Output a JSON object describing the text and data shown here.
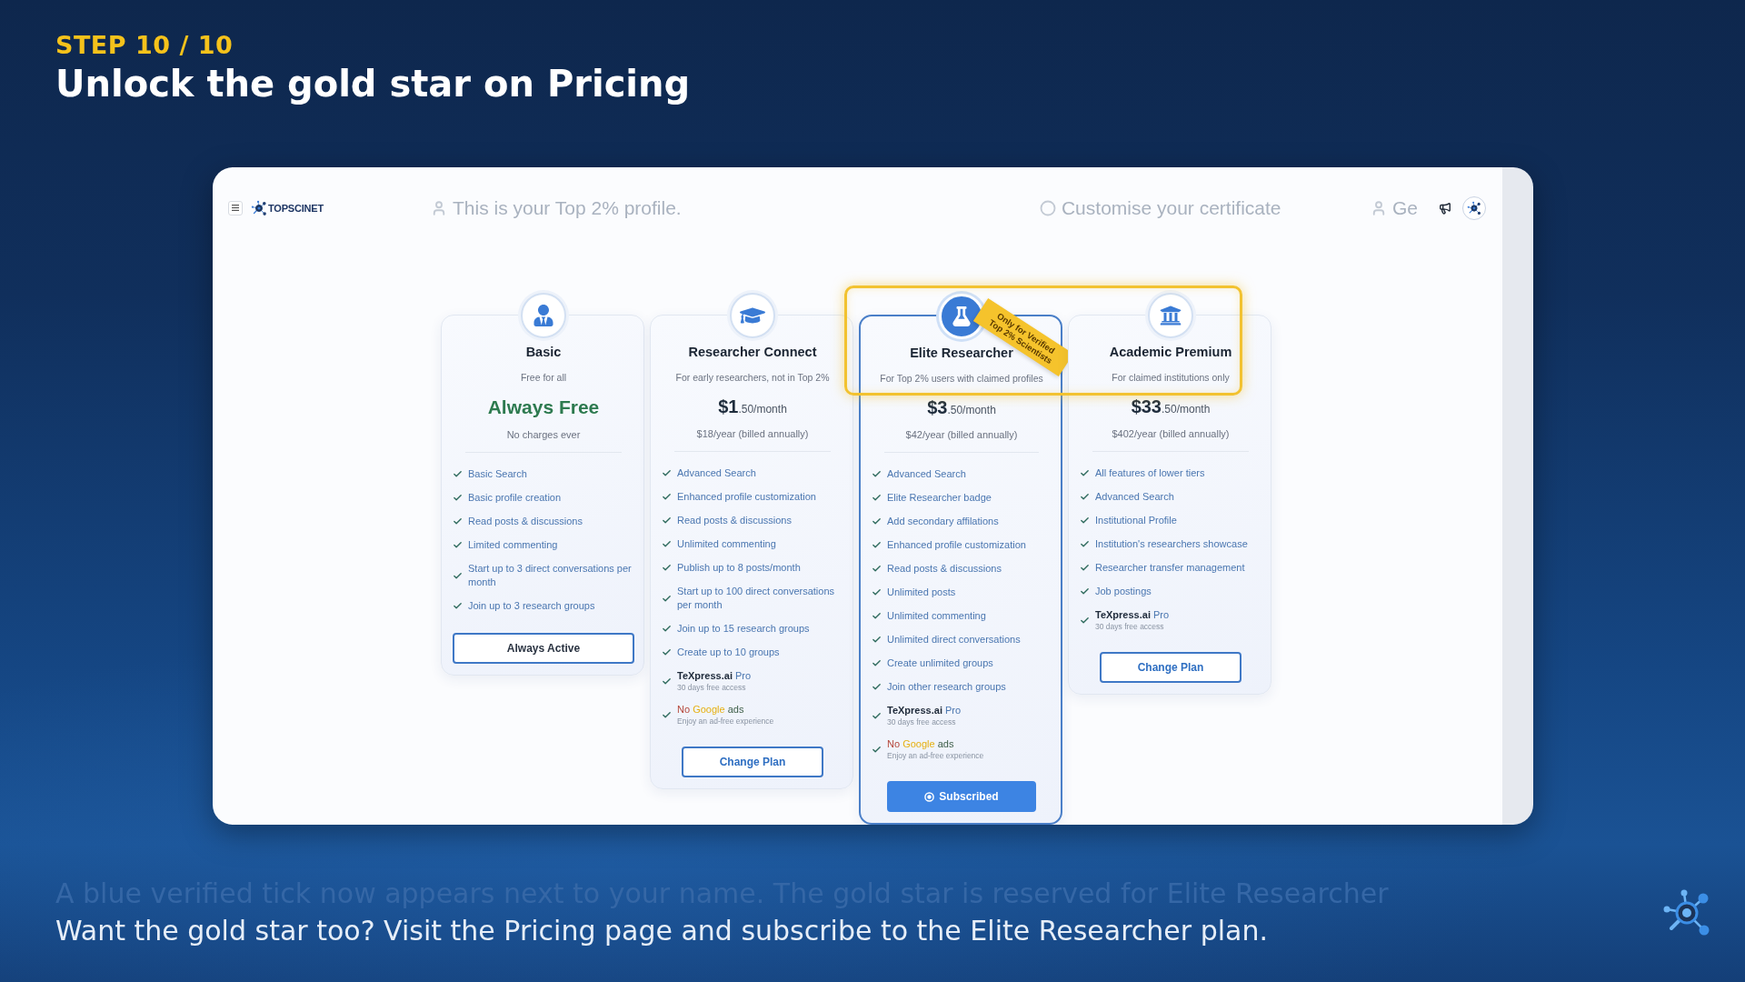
{
  "header": {
    "step": "STEP 10 / 10",
    "title": "Unlock the gold star on Pricing"
  },
  "app": {
    "top_bar": {
      "logo_text": "TOPSCINET",
      "faded_items": [
        {
          "text": "This is your Top 2% profile."
        },
        {
          "text": "Customise your certificate"
        },
        {
          "text": "Ge"
        }
      ]
    },
    "plans": [
      {
        "name": "Basic",
        "current": false,
        "subtitle": "Free for all",
        "price": {
          "kind": "free",
          "amount": "Always Free"
        },
        "billing": "No charges ever",
        "features": [
          {
            "kind": "plain",
            "text": "Basic Search"
          },
          {
            "kind": "plain",
            "text": "Basic profile creation"
          },
          {
            "kind": "plain",
            "text": "Read posts & discussions"
          },
          {
            "kind": "plain",
            "text": "Limited commenting"
          },
          {
            "kind": "plain",
            "text": "Start up to 3 direct conversations per month"
          },
          {
            "kind": "plain",
            "text": "Join up to 3 research groups"
          }
        ],
        "button": {
          "kind": "always_active",
          "label": "Always Active"
        }
      },
      {
        "name": "Researcher Connect",
        "current": false,
        "subtitle": "For early researchers, not in Top 2%",
        "price": {
          "kind": "paid",
          "amount": "$1",
          "period": ".50/month"
        },
        "billing": "$18/year (billed annually)",
        "features": [
          {
            "kind": "plain",
            "text": "Advanced Search"
          },
          {
            "kind": "plain",
            "text": "Enhanced profile customization"
          },
          {
            "kind": "plain",
            "text": "Read posts & discussions"
          },
          {
            "kind": "plain",
            "text": "Unlimited commenting"
          },
          {
            "kind": "plain",
            "text": "Publish up to 8 posts/month"
          },
          {
            "kind": "plain",
            "text": "Start up to 100 direct conversations per month"
          },
          {
            "kind": "plain",
            "text": "Join up to 15 research groups"
          },
          {
            "kind": "plain",
            "text": "Create up to 10 groups"
          },
          {
            "kind": "product",
            "product": "TeXpress.ai",
            "tier": "Pro",
            "note": "30 days free access"
          },
          {
            "kind": "no_ads",
            "lead": "No",
            "brand": "Google",
            "tail": "ads",
            "note": "Enjoy an ad-free experience"
          }
        ],
        "button": {
          "kind": "change",
          "label": "Change Plan"
        }
      },
      {
        "name": "Elite Researcher",
        "current": true,
        "ribbon": "Only for Verified Top 2% Scientists",
        "subtitle": "For Top 2% users with claimed profiles",
        "price": {
          "kind": "paid",
          "amount": "$3",
          "period": ".50/month"
        },
        "billing": "$42/year (billed annually)",
        "features": [
          {
            "kind": "plain",
            "text": "Advanced Search"
          },
          {
            "kind": "plain",
            "text": "Elite Researcher badge"
          },
          {
            "kind": "plain",
            "text": "Add secondary affilations"
          },
          {
            "kind": "plain",
            "text": "Enhanced profile customization"
          },
          {
            "kind": "plain",
            "text": "Read posts & discussions"
          },
          {
            "kind": "plain",
            "text": "Unlimited posts"
          },
          {
            "kind": "plain",
            "text": "Unlimited commenting"
          },
          {
            "kind": "plain",
            "text": "Unlimited direct conversations"
          },
          {
            "kind": "plain",
            "text": "Create unlimited groups"
          },
          {
            "kind": "plain",
            "text": "Join other research groups"
          },
          {
            "kind": "product",
            "product": "TeXpress.ai",
            "tier": "Pro",
            "note": "30 days free access"
          },
          {
            "kind": "no_ads",
            "lead": "No",
            "brand": "Google",
            "tail": "ads",
            "note": "Enjoy an ad-free experience"
          }
        ],
        "button": {
          "kind": "subscribed",
          "label": "Subscribed"
        }
      },
      {
        "name": "Academic Premium",
        "current": false,
        "subtitle": "For claimed institutions only",
        "price": {
          "kind": "paid",
          "amount": "$33",
          "period": ".50/month"
        },
        "billing": "$402/year (billed annually)",
        "features": [
          {
            "kind": "plain",
            "text": "All features of lower tiers"
          },
          {
            "kind": "plain",
            "text": "Advanced Search"
          },
          {
            "kind": "plain",
            "text": "Institutional Profile"
          },
          {
            "kind": "plain",
            "text": "Institution's researchers showcase"
          },
          {
            "kind": "plain",
            "text": "Researcher transfer management"
          },
          {
            "kind": "plain",
            "text": "Job postings"
          },
          {
            "kind": "product",
            "product": "TeXpress.ai",
            "tier": "Pro",
            "note": "30 days free access"
          }
        ],
        "button": {
          "kind": "change",
          "label": "Change Plan"
        }
      }
    ]
  },
  "captions": {
    "previous": "A blue verified tick now appears next to your name. The gold star is reserved for Elite Researcher",
    "current": "Want the gold star too? Visit the Pricing page and subscribe to the Elite Researcher plan."
  }
}
